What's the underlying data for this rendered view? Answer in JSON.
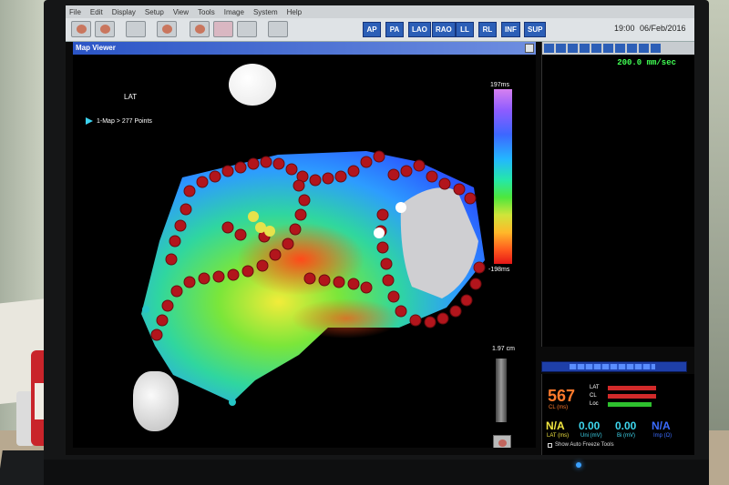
{
  "menu": [
    "File",
    "Edit",
    "Display",
    "Setup",
    "View",
    "Tools",
    "Image",
    "System",
    "Help"
  ],
  "toolbar": {
    "view_buttons": [
      "AP",
      "PA",
      "LAO",
      "RAO",
      "LL",
      "RL",
      "INF",
      "SUP"
    ],
    "time": "19:00",
    "date": "06/Feb/2016"
  },
  "map_viewer": {
    "title": "Map Viewer",
    "map_label": "LAT",
    "map_entry": "1-Map > 277 Points",
    "scale_max": "197ms",
    "scale_min": "-198ms",
    "distance": "1.97 cm"
  },
  "ecg": {
    "sweep_speed": "200.0 mm/sec"
  },
  "stats": {
    "cl_value": "567",
    "cl_label": "CL (ms)",
    "bars": [
      {
        "label": "LAT",
        "color": "#d22a2a",
        "fraction": 0.95
      },
      {
        "label": "CL",
        "color": "#d22a2a",
        "fraction": 0.95
      },
      {
        "label": "Loc",
        "color": "#2ec02e",
        "fraction": 0.85
      }
    ],
    "lat_value": "N/A",
    "lat_label": "LAT (ms)",
    "uni_value": "0.00",
    "uni_label": "Uni (mV)",
    "bi_value": "0.00",
    "bi_label": "Bi (mV)",
    "imp_value": "N/A",
    "imp_label": "Imp (Ω)",
    "freeze_label": "Show Auto Freeze Tools"
  },
  "colors": {
    "accent_blue": "#2c5fb7",
    "cl_orange": "#ff7a2c",
    "na_yellow": "#f2e640",
    "value_cyan": "#3ed7ef",
    "speed_green": "#41ff54"
  }
}
